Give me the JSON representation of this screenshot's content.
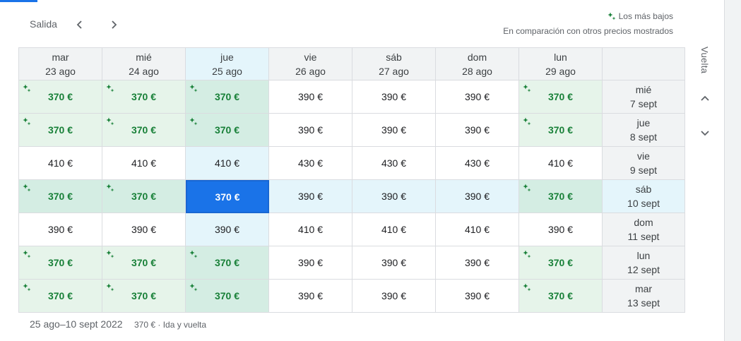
{
  "header": {
    "salida_label": "Salida",
    "legend_title": "Los más bajos",
    "legend_subtitle": "En comparación con otros precios mostrados",
    "vuelta_label": "Vuelta"
  },
  "colors": {
    "accent": "#1a73e8",
    "low_price": "#188038",
    "low_bg": "#e6f4ea",
    "selected_bg": "#e4f5fb"
  },
  "icons": {
    "prev": "chevron-left-icon",
    "next": "chevron-right-icon",
    "up": "chevron-up-icon",
    "down": "chevron-down-icon",
    "low": "sparkle-icon"
  },
  "columns": [
    {
      "day": "mar",
      "date": "23 ago"
    },
    {
      "day": "mié",
      "date": "24 ago"
    },
    {
      "day": "jue",
      "date": "25 ago"
    },
    {
      "day": "vie",
      "date": "26 ago"
    },
    {
      "day": "sáb",
      "date": "27 ago"
    },
    {
      "day": "dom",
      "date": "28 ago"
    },
    {
      "day": "lun",
      "date": "29 ago"
    }
  ],
  "rows": [
    {
      "day": "mié",
      "date": "7 sept",
      "prices": [
        "370 €",
        "370 €",
        "370 €",
        "390 €",
        "390 €",
        "390 €",
        "370 €"
      ],
      "low": [
        true,
        true,
        true,
        false,
        false,
        false,
        true
      ]
    },
    {
      "day": "jue",
      "date": "8 sept",
      "prices": [
        "370 €",
        "370 €",
        "370 €",
        "390 €",
        "390 €",
        "390 €",
        "370 €"
      ],
      "low": [
        true,
        true,
        true,
        false,
        false,
        false,
        true
      ]
    },
    {
      "day": "vie",
      "date": "9 sept",
      "prices": [
        "410 €",
        "410 €",
        "410 €",
        "430 €",
        "430 €",
        "430 €",
        "410 €"
      ],
      "low": [
        false,
        false,
        false,
        false,
        false,
        false,
        false
      ]
    },
    {
      "day": "sáb",
      "date": "10 sept",
      "prices": [
        "370 €",
        "370 €",
        "370 €",
        "390 €",
        "390 €",
        "390 €",
        "370 €"
      ],
      "low": [
        true,
        true,
        true,
        false,
        false,
        false,
        true
      ]
    },
    {
      "day": "dom",
      "date": "11 sept",
      "prices": [
        "390 €",
        "390 €",
        "390 €",
        "410 €",
        "410 €",
        "410 €",
        "390 €"
      ],
      "low": [
        false,
        false,
        false,
        false,
        false,
        false,
        false
      ]
    },
    {
      "day": "lun",
      "date": "12 sept",
      "prices": [
        "370 €",
        "370 €",
        "370 €",
        "390 €",
        "390 €",
        "390 €",
        "370 €"
      ],
      "low": [
        true,
        true,
        true,
        false,
        false,
        false,
        true
      ]
    },
    {
      "day": "mar",
      "date": "13 sept",
      "prices": [
        "370 €",
        "370 €",
        "370 €",
        "390 €",
        "390 €",
        "390 €",
        "370 €"
      ],
      "low": [
        true,
        true,
        true,
        false,
        false,
        false,
        true
      ]
    }
  ],
  "selection": {
    "column_index": 2,
    "row_index": 3
  },
  "footer": {
    "dates": "25 ago–10 sept 2022",
    "info": "370 € · Ida y vuelta"
  }
}
